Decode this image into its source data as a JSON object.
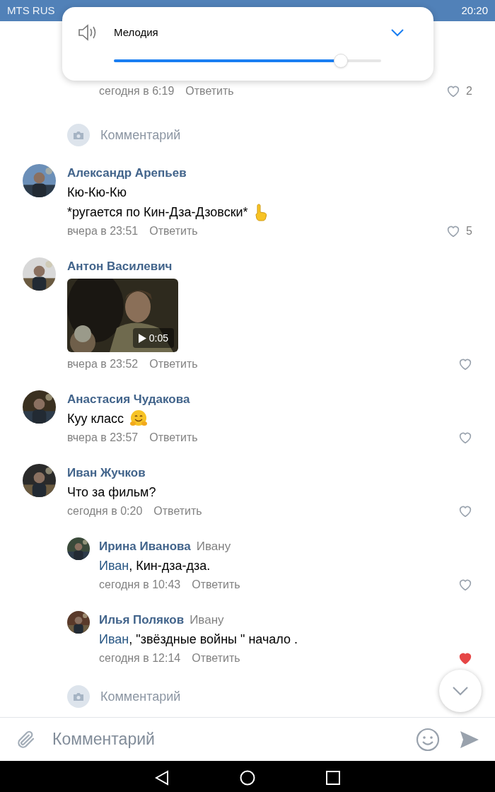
{
  "status_bar": {
    "carrier": "MTS RUS",
    "time": "20:20"
  },
  "volume_popup": {
    "label": "Мелодия",
    "level": 0.85
  },
  "comments": [
    {
      "kind": "partial",
      "time": "сегодня в 6:19",
      "reply": "Ответить",
      "likes": "2",
      "liked": false
    },
    {
      "kind": "composer",
      "placeholder": "Комментарий"
    },
    {
      "kind": "comment",
      "author": "Александр Арепьев",
      "lines": [
        {
          "text": "Кю-Кю-Кю"
        },
        {
          "text": "*ругается по Кин-Дза-Дзовски*",
          "kind": "emoji"
        }
      ],
      "time": "вчера в 23:51",
      "reply": "Ответить",
      "likes": "5",
      "liked": false
    },
    {
      "kind": "comment",
      "author": "Антон Василевич",
      "video": {
        "duration": "0:05"
      },
      "time": "вчера в 23:52",
      "reply": "Ответить",
      "liked": false
    },
    {
      "kind": "comment",
      "author": "Анастасия Чудакова",
      "lines": [
        {
          "text": "Куу класс",
          "kind": "emoji"
        }
      ],
      "time": "вчера в 23:57",
      "reply": "Ответить",
      "liked": false
    },
    {
      "kind": "comment",
      "author": "Иван Жучков",
      "lines": [
        {
          "text": "Что за фильм?"
        }
      ],
      "time": "сегодня в 0:20",
      "reply": "Ответить",
      "liked": false
    },
    {
      "kind": "reply",
      "author": "Ирина Иванова",
      "to": "Ивану",
      "mention": "Иван",
      "lines": [
        {
          "text": ", Кин-дза-дза."
        }
      ],
      "time": "сегодня в 10:43",
      "reply": "Ответить",
      "liked": false
    },
    {
      "kind": "reply",
      "author": "Илья Поляков",
      "to": "Ивану",
      "mention": "Иван",
      "lines": [
        {
          "text": ", \"звёздные войны \" начало ."
        }
      ],
      "time": "сегодня в 12:14",
      "reply": "Ответить",
      "liked": true
    },
    {
      "kind": "composer",
      "placeholder": "Комментарий"
    }
  ],
  "input_bar": {
    "placeholder": "Комментарий"
  }
}
